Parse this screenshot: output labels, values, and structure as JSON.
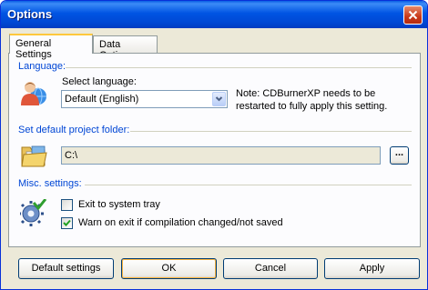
{
  "window": {
    "title": "Options"
  },
  "tabs": [
    {
      "label": "General Settings",
      "active": true
    },
    {
      "label": "Data Options",
      "active": false
    }
  ],
  "language": {
    "group_label": "Language:",
    "select_label": "Select language:",
    "selected_value": "Default (English)",
    "note": "Note: CDBurnerXP needs to be restarted to fully apply this setting."
  },
  "project_folder": {
    "group_label": "Set default project folder:",
    "path_value": "C:\\",
    "browse_label": "..."
  },
  "misc": {
    "group_label": "Misc. settings:",
    "options": [
      {
        "label": "Exit to system tray",
        "checked": false
      },
      {
        "label": "Warn on exit if compilation changed/not saved",
        "checked": true
      }
    ]
  },
  "buttons": {
    "default_settings": "Default settings",
    "ok": "OK",
    "cancel": "Cancel",
    "apply": "Apply"
  },
  "colors": {
    "titlebar": "#0054e3",
    "group_label": "#0046d5",
    "dialog_bg": "#ece9d8",
    "checkmark": "#21a121"
  }
}
